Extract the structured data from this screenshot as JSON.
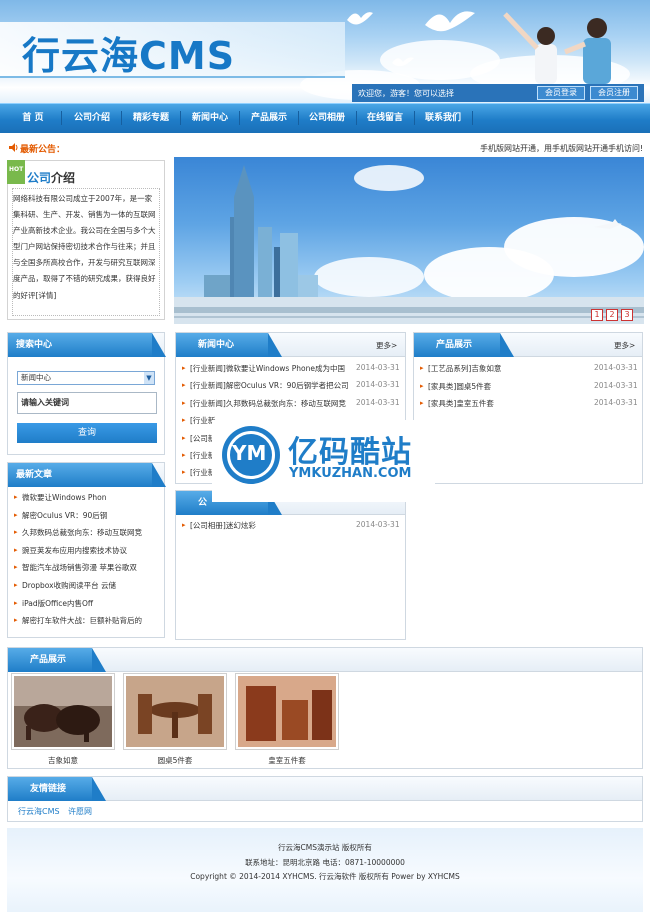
{
  "header": {
    "logo_text": "行云海CMS",
    "welcome": "欢迎您，游客！您可以选择",
    "login_label": "会员登录",
    "register_label": "会员注册"
  },
  "nav": {
    "items": [
      "首 页",
      "公司介绍",
      "精彩专题",
      "新闻中心",
      "产品展示",
      "公司相册",
      "在线留言",
      "联系我们"
    ]
  },
  "notice": {
    "label": "最新公告：",
    "text": "手机版网站开通，用手机版网站开通手机访问!"
  },
  "about": {
    "tag": "HOT",
    "title_accent": "公司",
    "title_rest": "介绍",
    "body": "网络科技有限公司成立于2007年，是一家集科研、生产、开发、销售为一体的互联网产业高新技术企业。我公司在全国与多个大型门户网站保持密切技术合作与往来；并且与全国多所高校合作，开发与研究互联网深度产品，取得了不错的研究成果，获得良好的好评[详情]"
  },
  "banner": {
    "slides": [
      "1",
      "2",
      "3"
    ]
  },
  "search": {
    "title": "搜索中心",
    "select_value": "新闻中心",
    "input_placeholder": "请输入关键词",
    "button": "查询"
  },
  "latest": {
    "title": "最新文章",
    "items": [
      "微软要让Windows Phon",
      "解密Oculus VR：90后钢",
      "久邦数码总裁张向东：移动互联网竞",
      "豌豆荚发布应用内搜索技术协议",
      "智能汽车战场销售弥漫 苹果谷歌双",
      "Dropbox收购阅读平台 云储",
      "iPad版Office内售Off",
      "解密打车软件大战：巨额补贴背后的"
    ]
  },
  "news": {
    "title": "新闻中心",
    "more": "更多>",
    "items": [
      {
        "text": "[行业新闻]微软要让Windows Phone成为中国",
        "date": "2014-03-31"
      },
      {
        "text": "[行业新闻]解密Oculus VR：90后钢学者把公司",
        "date": "2014-03-31"
      },
      {
        "text": "[行业新闻]久邦数码总裁张向东：移动互联网竞",
        "date": "2014-03-31"
      },
      {
        "text": "[行业新",
        "date": ""
      },
      {
        "text": "[公司新",
        "date": ""
      },
      {
        "text": "[行业新",
        "date": ""
      },
      {
        "text": "[行业新",
        "date": ""
      }
    ]
  },
  "products_list": {
    "title": "产品展示",
    "more": "更多>",
    "items": [
      {
        "text": "[工艺品系列]吉象如意",
        "date": "2014-03-31"
      },
      {
        "text": "[家具类]圆桌5件套",
        "date": "2014-03-31"
      },
      {
        "text": "[家具类]皇室五件套",
        "date": "2014-03-31"
      }
    ]
  },
  "album": {
    "title": "公",
    "items": [
      {
        "text": "[公司相册]迷幻炫彩",
        "date": "2014-03-31"
      }
    ]
  },
  "gallery": {
    "title": "产品展示",
    "items": [
      {
        "caption": "吉象如意"
      },
      {
        "caption": "圆桌5件套"
      },
      {
        "caption": "皇室五件套"
      }
    ]
  },
  "links": {
    "title": "友情链接",
    "items": [
      "行云海CMS",
      "许愿网"
    ]
  },
  "watermark": {
    "cn": "亿码酷站",
    "en": "YMKUZHAN.COM",
    "logo_letters": "YM"
  },
  "footer": {
    "line1": "行云海CMS演示站 版权所有",
    "line2": "联系地址：昆明北京路 电话：0871-10000000",
    "line3": "Copyright © 2014-2014 XYHCMS. 行云海软件 版权所有 Power by XYHCMS"
  },
  "colors": {
    "brand_blue": "#1f7dc8",
    "notice_orange": "#e35a00"
  }
}
